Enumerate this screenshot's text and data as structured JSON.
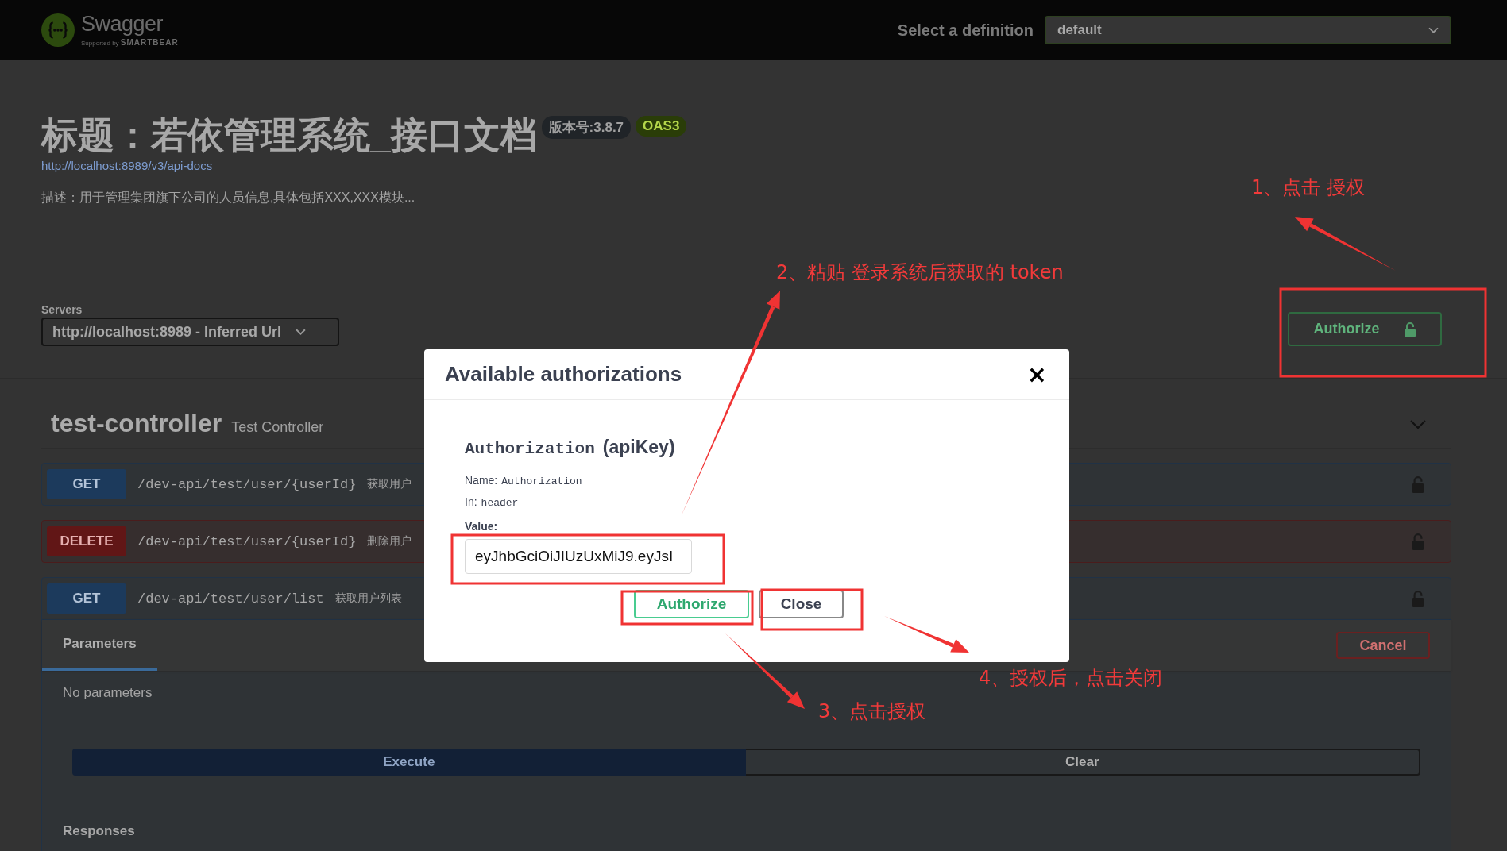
{
  "header": {
    "logo_text": "Swagger",
    "logo_subtitle_prefix": "Supported by",
    "logo_subtitle_brand": "SMARTBEAR",
    "definition_label": "Select a definition",
    "definition_value": "default"
  },
  "info": {
    "title": "标题：若依管理系统_接口文档",
    "version_badge": "版本号:3.8.7",
    "oas_badge": "OAS3",
    "url": "http://localhost:8989/v3/api-docs",
    "description": "描述：用于管理集团旗下公司的人员信息,具体包括XXX,XXX模块..."
  },
  "servers": {
    "label": "Servers",
    "value": "http://localhost:8989 - Inferred Url"
  },
  "authorize_button": "Authorize",
  "tag": {
    "name": "test-controller",
    "description": "Test Controller",
    "expanded": true
  },
  "operations": [
    {
      "method": "GET",
      "path": "/dev-api/test/user/{userId}",
      "summary": "获取用户",
      "expanded": false
    },
    {
      "method": "DELETE",
      "path": "/dev-api/test/user/{userId}",
      "summary": "删除用户",
      "expanded": false
    },
    {
      "method": "GET",
      "path": "/dev-api/test/user/list",
      "summary": "获取用户列表",
      "expanded": true
    }
  ],
  "expanded_operation": {
    "tabs": [
      {
        "label": "Parameters",
        "selected": true
      }
    ],
    "cancel_button": "Cancel",
    "no_parameters": "No parameters",
    "execute_button": "Execute",
    "clear_button": "Clear",
    "responses_heading": "Responses"
  },
  "modal": {
    "title": "Available authorizations",
    "close_glyph": "×",
    "scheme_name": "Authorization",
    "scheme_type": "(apiKey)",
    "name_label": "Name:",
    "name_value": "Authorization",
    "in_label": "In:",
    "in_value": "header",
    "value_label": "Value:",
    "value": "eyJhbGciOiJIUzUxMiJ9.eyJsI",
    "authorize_button": "Authorize",
    "close_button": "Close"
  },
  "annotations": [
    {
      "text": "1、点击 授权"
    },
    {
      "text": "2、粘贴 登录系统后获取的 token"
    },
    {
      "text": "3、点击授权"
    },
    {
      "text": "4、授权后，点击关闭"
    }
  ]
}
